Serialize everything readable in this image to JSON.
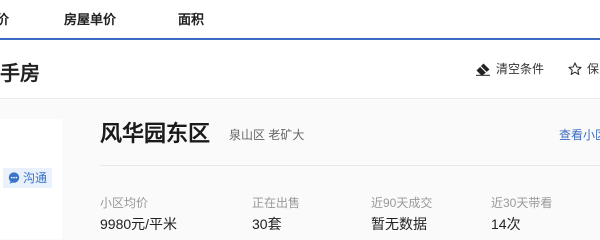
{
  "nav": {
    "items": [
      "价",
      "房屋单价",
      "面积"
    ]
  },
  "section": {
    "title": "手房",
    "clear_label": "清空条件",
    "save_label": "保"
  },
  "listing": {
    "chat_label": "沟通",
    "name": "风华园东区",
    "location": "泉山区 老矿大",
    "view_link": "查看小区",
    "stats": [
      {
        "label": "小区均价",
        "value": "9980元/平米"
      },
      {
        "label": "正在出售",
        "value": "30套"
      },
      {
        "label": "近90天成交",
        "value": "暂无数据"
      },
      {
        "label": "近30天带看",
        "value": "14次"
      }
    ]
  },
  "colors": {
    "accent": "#3d6cc2",
    "chat_bg": "#e8f1fc"
  },
  "icons": {
    "clear": "eraser-icon",
    "save": "star-outline-icon",
    "chat": "chat-bubble-icon"
  }
}
